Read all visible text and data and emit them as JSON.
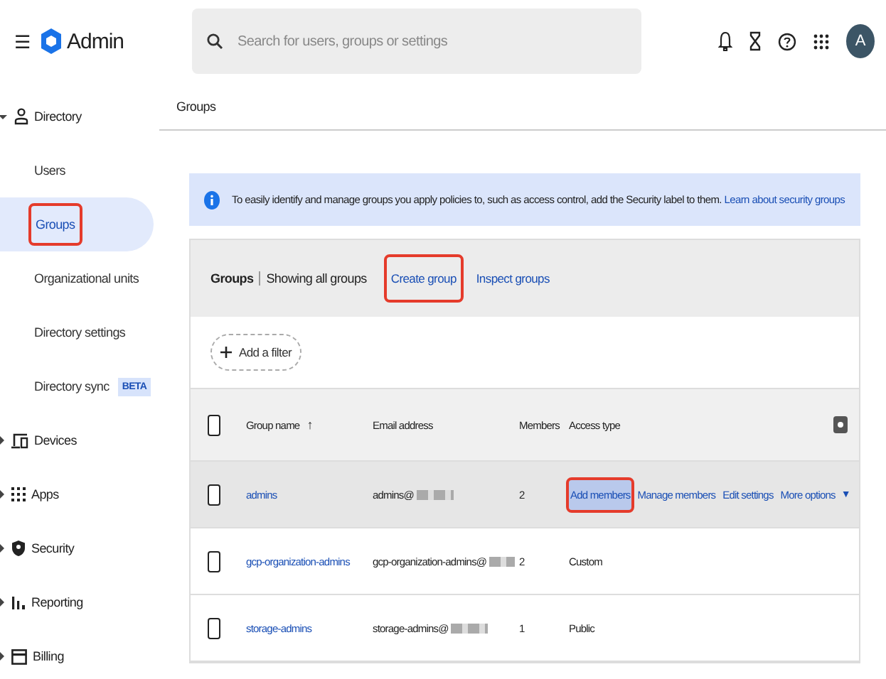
{
  "header": {
    "menu": "☰",
    "product": "Admin",
    "search": {
      "placeholder": "Search for users, groups or settings"
    },
    "avatar": "A"
  },
  "sidebar": {
    "items": [
      {
        "label": "Directory",
        "kind": "person",
        "expanded": true,
        "children": [
          {
            "label": "Users",
            "selected": false,
            "highlighted": false
          },
          {
            "label": "Groups",
            "selected": true,
            "highlighted": true
          },
          {
            "label": "Organizational units",
            "selected": false,
            "highlighted": false
          },
          {
            "label": "Directory settings",
            "selected": false,
            "highlighted": false
          },
          {
            "label": "Directory sync",
            "badge": "BETA",
            "selected": false,
            "highlighted": false
          }
        ]
      },
      {
        "label": "Devices",
        "kind": "devices",
        "expanded": false
      },
      {
        "label": "Apps",
        "kind": "grid",
        "expanded": false
      },
      {
        "label": "Security",
        "kind": "shield",
        "expanded": false
      },
      {
        "label": "Reporting",
        "kind": "bars",
        "expanded": false
      },
      {
        "label": "Billing",
        "kind": "card",
        "expanded": false
      }
    ]
  },
  "breadcrumb": "Groups",
  "banner": {
    "text": "To easily identify and manage groups you apply policies to, such as access control, add the Security label to them.",
    "link": "Learn about security groups"
  },
  "card": {
    "title": "Groups",
    "subtitle": "Showing all groups",
    "actions": [
      {
        "label": "Create group",
        "highlighted": true
      },
      {
        "label": "Inspect groups",
        "highlighted": false
      }
    ],
    "filter": "Add a filter",
    "table": {
      "columns": [
        "Group name",
        "Email address",
        "Members",
        "Access type"
      ],
      "sort_arrow": "↑",
      "select_all_checked": false,
      "rows": [
        {
          "name": "admins",
          "email": "admins@",
          "members": "2",
          "hovered": true,
          "checked": false,
          "actions": [
            {
              "label": "Add members",
              "highlighted": true
            },
            {
              "label": "Manage members",
              "highlighted": false
            },
            {
              "label": "Edit settings",
              "highlighted": false
            },
            {
              "label": "More options",
              "highlighted": false,
              "caret": "▼"
            }
          ]
        },
        {
          "name": "gcp-organization-admins",
          "email": "gcp-organization-admins@",
          "members": "2",
          "hovered": false,
          "checked": false,
          "access_type": "Custom"
        },
        {
          "name": "storage-admins",
          "email": "storage-admins@",
          "members": "1",
          "hovered": false,
          "checked": false,
          "access_type": "Public"
        }
      ]
    }
  }
}
